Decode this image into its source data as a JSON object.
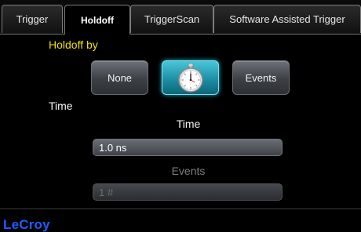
{
  "tabs": [
    {
      "label": "Trigger",
      "active": false
    },
    {
      "label": "Holdoff",
      "active": true
    },
    {
      "label": "TriggerScan",
      "active": false
    },
    {
      "label": "Software Assisted Trigger",
      "active": false
    }
  ],
  "holdoff": {
    "section_title": "Holdoff by",
    "options": [
      {
        "label": "None",
        "selected": false
      },
      {
        "label": "",
        "icon": "stopwatch-icon",
        "selected": true
      },
      {
        "label": "Events",
        "selected": false
      }
    ],
    "mode_label": "Time"
  },
  "time_field": {
    "label": "Time",
    "value": "1.0 ns",
    "enabled": true
  },
  "events_field": {
    "label": "Events",
    "value": "1 #",
    "enabled": false
  },
  "footer": {
    "brand": "LeCroy"
  },
  "colors": {
    "section_title": "#f0e000",
    "selected_button": "#1b8aa0",
    "brand": "#1f5cff",
    "background": "#000000"
  }
}
